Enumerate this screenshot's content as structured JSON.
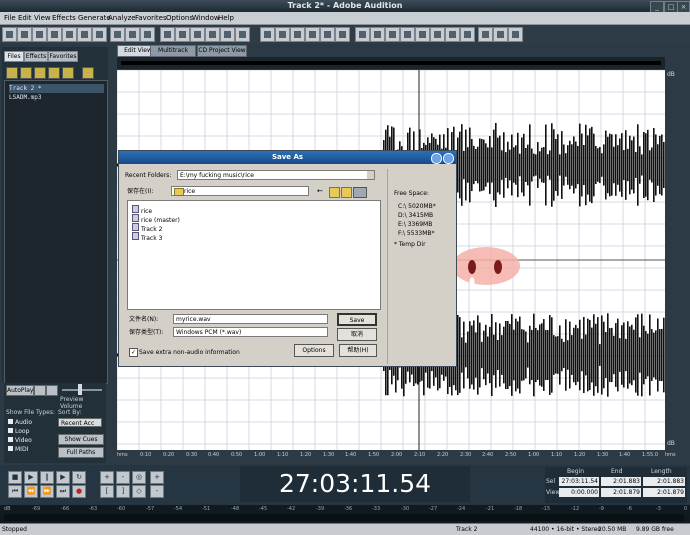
{
  "window": {
    "title": "Track 2* - Adobe Audition"
  },
  "menu": [
    "File",
    "Edit",
    "View",
    "Effects",
    "Generate",
    "Analyze",
    "Favorites",
    "Options",
    "Window",
    "Help"
  ],
  "left_panel": {
    "tabs": [
      "Files",
      "Effects",
      "Favorites"
    ],
    "files": [
      "Track 2 *",
      "LSADM.mp3"
    ],
    "auto_play_label": "AutoPlay",
    "loop_label": "Loop",
    "preview_volume_label": "Preview Volume",
    "show_file_types_label": "Show File Types:",
    "file_types": [
      "Audio",
      "Loop",
      "Video",
      "MIDI"
    ],
    "sort_by_label": "Sort By:",
    "sort_value": "Recent Acc",
    "show_cues_button": "Show Cues",
    "full_paths_button": "Full Paths"
  },
  "view_tabs": [
    "Edit View",
    "Multitrack View",
    "CD Project View"
  ],
  "time_ruler": [
    "hms",
    "0:10",
    "0:20",
    "0:30",
    "0:40",
    "0:50",
    "1:00",
    "1:10",
    "1:20",
    "1:30",
    "1:40",
    "1:50",
    "2:00",
    "2:10",
    "2:20",
    "2:30",
    "2:40",
    "2:50",
    "1:00",
    "1:10",
    "1:20",
    "1:30",
    "1:40",
    "1:55.0",
    "hms"
  ],
  "db_scale": {
    "top": "dB",
    "bottom": "dB"
  },
  "dialog": {
    "title": "Save As",
    "recent_folders_label": "Recent Folders:",
    "recent_folder_value": "E:\\my fucking music\\rice",
    "save_in_label": "保存在(I):",
    "save_in_value": "rice",
    "files": [
      "rice",
      "rice (master)",
      "Track 2",
      "Track 3"
    ],
    "filename_label": "文件名(N):",
    "filename_value": "myrice.wav",
    "filetype_label": "保存类型(T):",
    "filetype_value": "Windows PCM (*.wav)",
    "save_button": "Save",
    "cancel_button": "取消",
    "help_button": "帮助(H)",
    "options_button": "Options",
    "extra_info_label": "Save extra non-audio information",
    "extra_info_checked": true,
    "free_space_label": "Free Space:",
    "drives": [
      "C:\\  5020MB*",
      "D:\\  3415MB",
      "E:\\  3369MB",
      "F:\\  5533MB*"
    ],
    "temp_dir_label": "* Temp Dir"
  },
  "transport": {
    "timecode": "27:03:11.54"
  },
  "selection": {
    "headers": [
      "Begin",
      "End",
      "Length"
    ],
    "rows": [
      {
        "label": "Sel",
        "begin": "27:03:11.54",
        "end": "2:01.883",
        "length": "2:01.883"
      },
      {
        "label": "View",
        "begin": "0:00.000",
        "end": "2:01.879",
        "length": "2:01.879"
      }
    ]
  },
  "meter_ticks": [
    "dB",
    "-69",
    "-66",
    "-63",
    "-60",
    "-57",
    "-54",
    "-51",
    "-48",
    "-45",
    "-42",
    "-39",
    "-36",
    "-33",
    "-30",
    "-27",
    "-24",
    "-21",
    "-18",
    "-15",
    "-12",
    "-9",
    "-6",
    "-3",
    "0"
  ],
  "status": {
    "state": "Stopped",
    "track": "Track 2",
    "format": "44100 • 16-bit • Stereo",
    "size": "20.50 MB",
    "free": "9.89 GB free"
  }
}
